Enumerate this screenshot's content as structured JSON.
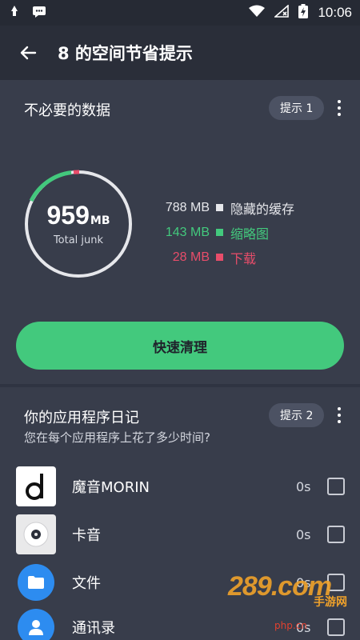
{
  "status_bar": {
    "time": "10:06"
  },
  "app_bar": {
    "title": "8 的空间节省提示"
  },
  "junk_section": {
    "title": "不必要的数据",
    "tip_label": "提示 1",
    "total_value": "959",
    "total_unit": "MB",
    "total_label": "Total junk",
    "legend": [
      {
        "size": "788 MB",
        "label": "隐藏的缓存",
        "color": "#e6e7eb"
      },
      {
        "size": "143 MB",
        "label": "缩略图",
        "color": "#43c97d"
      },
      {
        "size": "28 MB",
        "label": "下载",
        "color": "#e84d6a"
      }
    ],
    "clean_button": "快速清理"
  },
  "diary_section": {
    "title": "你的应用程序日记",
    "tip_label": "提示 2",
    "subtitle": "您在每个应用程序上花了多少时间?",
    "apps": [
      {
        "name": "魔音MORIN",
        "time": "0s",
        "icon": "morin-icon"
      },
      {
        "name": "卡音",
        "time": "0s",
        "icon": "kayin-icon"
      },
      {
        "name": "文件",
        "time": "0s",
        "icon": "folder-icon"
      },
      {
        "name": "通讯录",
        "time": "0s",
        "icon": "contacts-icon"
      }
    ]
  },
  "watermark": {
    "brand": "289.com",
    "brand_sub": "手游网",
    "site": "php.cn"
  },
  "colors": {
    "accent": "#43c97d",
    "danger": "#e84d6a",
    "background": "#2f3442",
    "card": "#383d4b"
  }
}
